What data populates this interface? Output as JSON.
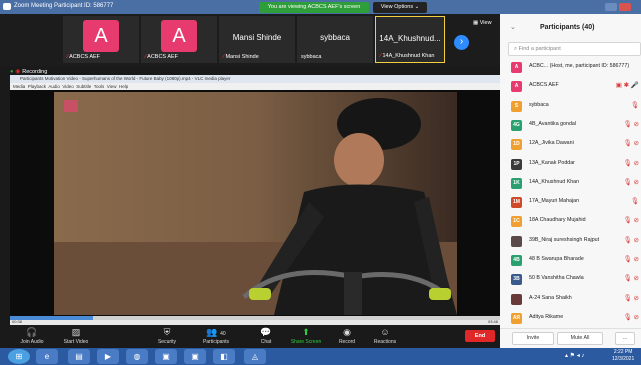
{
  "window": {
    "title": "Zoom Meeting Participant ID: 586777"
  },
  "share_banner": "You are viewing ACBCS AEF's screen",
  "view_options": "View Options ⌄",
  "view_label": "View",
  "video_strip": [
    {
      "type": "avatar",
      "letter": "A",
      "name": "ACBCS AEF"
    },
    {
      "type": "avatar",
      "letter": "A",
      "name": "ACBCS AEF"
    },
    {
      "type": "name",
      "big": "Mansi Shinde",
      "name": "Mansi Shinde"
    },
    {
      "type": "name",
      "big": "sybbaca",
      "name": "sybbaca"
    },
    {
      "type": "name",
      "big": "14A_Khushnud...",
      "name": "14A_Khushnud Khan"
    }
  ],
  "recording": "Recording",
  "media_player": {
    "title": "Participants Motivation Video - Superhumans of the World - Future Baby (1080p).mp4 - VLC media player",
    "menu": [
      "Media",
      "Playback",
      "Audio",
      "Video",
      "Subtitle",
      "Tools",
      "View",
      "Help"
    ],
    "time_elapsed": "00:38",
    "time_total": "03:46",
    "progress": 0.17
  },
  "toolbar": {
    "join_audio": "Join Audio",
    "start_video": "Start Video",
    "security": "Security",
    "participants": "Participants",
    "participants_count": "40",
    "chat": "Chat",
    "share_screen": "Share Screen",
    "record": "Record",
    "reactions": "Reactions",
    "end": "End"
  },
  "panel": {
    "title": "Participants (40)",
    "search_placeholder": "Find a participant",
    "participants": [
      {
        "initials": "A",
        "color": "#e73a6f",
        "name": "ACBC... (Host, me, participant ID: 586777)",
        "icons": ""
      },
      {
        "initials": "A",
        "color": "#e73a6f",
        "name": "ACBCS AEF",
        "icons": "▣ ✱ 🎤"
      },
      {
        "initials": "S",
        "color": "#f0a030",
        "name": "sybbaca",
        "icons": "🎙"
      },
      {
        "initials": "4G",
        "color": "#2aa070",
        "name": "4B_Avantika gondal",
        "icons": "🎙 ⊘"
      },
      {
        "initials": "1D",
        "color": "#f0a030",
        "name": "12A_Jivika Dawani",
        "icons": "🎙 ⊘"
      },
      {
        "initials": "1P",
        "color": "#3a3a3a",
        "name": "13A_Kanak Poddar",
        "icons": "🎙 ⊘"
      },
      {
        "initials": "1K",
        "color": "#2aa070",
        "name": "14A_Khushnud Khan",
        "icons": "🎙 ⊘"
      },
      {
        "initials": "1M",
        "color": "#d04a2a",
        "name": "17A_Mayuri Mahajan",
        "icons": "🎙"
      },
      {
        "initials": "1C",
        "color": "#f0a030",
        "name": "18A Chaudhary Mujahid",
        "icons": "🎙 ⊘"
      },
      {
        "initials": "",
        "color": "#5a4a4a",
        "name": "39B_Niraj sureshsingh Rajput",
        "icons": "🎙 ⊘"
      },
      {
        "initials": "4B",
        "color": "#2aa070",
        "name": "48 B Swarupa Bharade",
        "icons": "🎙 ⊘"
      },
      {
        "initials": "3B",
        "color": "#3a5a8a",
        "name": "50 B Vanshitha Chawla",
        "icons": "🎙 ⊘"
      },
      {
        "initials": "",
        "color": "#6a3a3a",
        "name": "A-24 Sana Shaikh",
        "icons": "🎙 ⊘"
      },
      {
        "initials": "AR",
        "color": "#f0a030",
        "name": "Aditya Rikame",
        "icons": "🎙 ⊘"
      }
    ],
    "invite": "Invite",
    "mute_all": "Mute All",
    "more": "..."
  },
  "taskbar": {
    "time": "2:22 PM",
    "date": "12/3/2021"
  }
}
